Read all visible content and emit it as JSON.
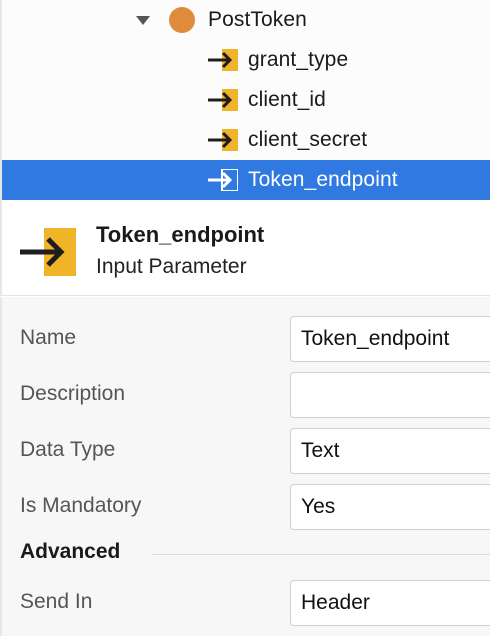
{
  "tree": {
    "action": {
      "label": "PostToken",
      "icon": "action-circle-icon",
      "color": "#e08a3c"
    },
    "parameters": [
      {
        "label": "grant_type",
        "icon": "input-parameter-icon",
        "selected": false
      },
      {
        "label": "client_id",
        "icon": "input-parameter-icon",
        "selected": false
      },
      {
        "label": "client_secret",
        "icon": "input-parameter-icon",
        "selected": false
      },
      {
        "label": "Token_endpoint",
        "icon": "input-parameter-icon",
        "selected": true
      }
    ],
    "selection_color": "#2f79e0"
  },
  "header": {
    "title": "Token_endpoint",
    "subtitle": "Input Parameter",
    "icon": "input-parameter-icon"
  },
  "properties": {
    "name": {
      "label": "Name",
      "value": "Token_endpoint"
    },
    "description": {
      "label": "Description",
      "value": ""
    },
    "data_type": {
      "label": "Data Type",
      "value": "Text"
    },
    "is_mandatory": {
      "label": "Is Mandatory",
      "value": "Yes"
    },
    "advanced_section": "Advanced",
    "send_in": {
      "label": "Send In",
      "value": "Header"
    }
  },
  "colors": {
    "icon_yellow": "#f0b429",
    "arrow": "#1e1e1e"
  }
}
